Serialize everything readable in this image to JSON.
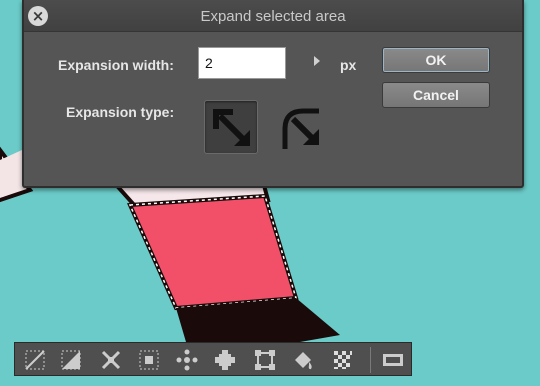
{
  "dialog": {
    "title": "Expand selected area",
    "close_icon": "close-icon",
    "expansion_width_label": "Expansion width:",
    "expansion_width_value": "2",
    "unit_label": "px",
    "expansion_type_label": "Expansion type:",
    "expansion_types": [
      {
        "icon": "square-corner-expand-icon",
        "selected": true
      },
      {
        "icon": "round-corner-expand-icon",
        "selected": false
      }
    ],
    "ok_label": "OK",
    "cancel_label": "Cancel"
  },
  "toolbar": {
    "tools": [
      {
        "icon": "deselect-icon"
      },
      {
        "icon": "invert-selection-icon"
      },
      {
        "icon": "expand-selection-icon"
      },
      {
        "icon": "shrink-selection-icon"
      },
      {
        "icon": "selection-dots-icon"
      },
      {
        "icon": "move-selection-icon"
      },
      {
        "icon": "transform-selection-icon"
      },
      {
        "icon": "fill-selection-icon"
      },
      {
        "icon": "transparency-checker-icon"
      },
      {
        "icon": "film-strip-icon"
      }
    ]
  },
  "colors": {
    "canvas_bg": "#6bcbc8",
    "fill_pink": "#f25068",
    "outline": "#1a0a0a",
    "dialog_bg": "#555555",
    "button_face": "#808080"
  }
}
